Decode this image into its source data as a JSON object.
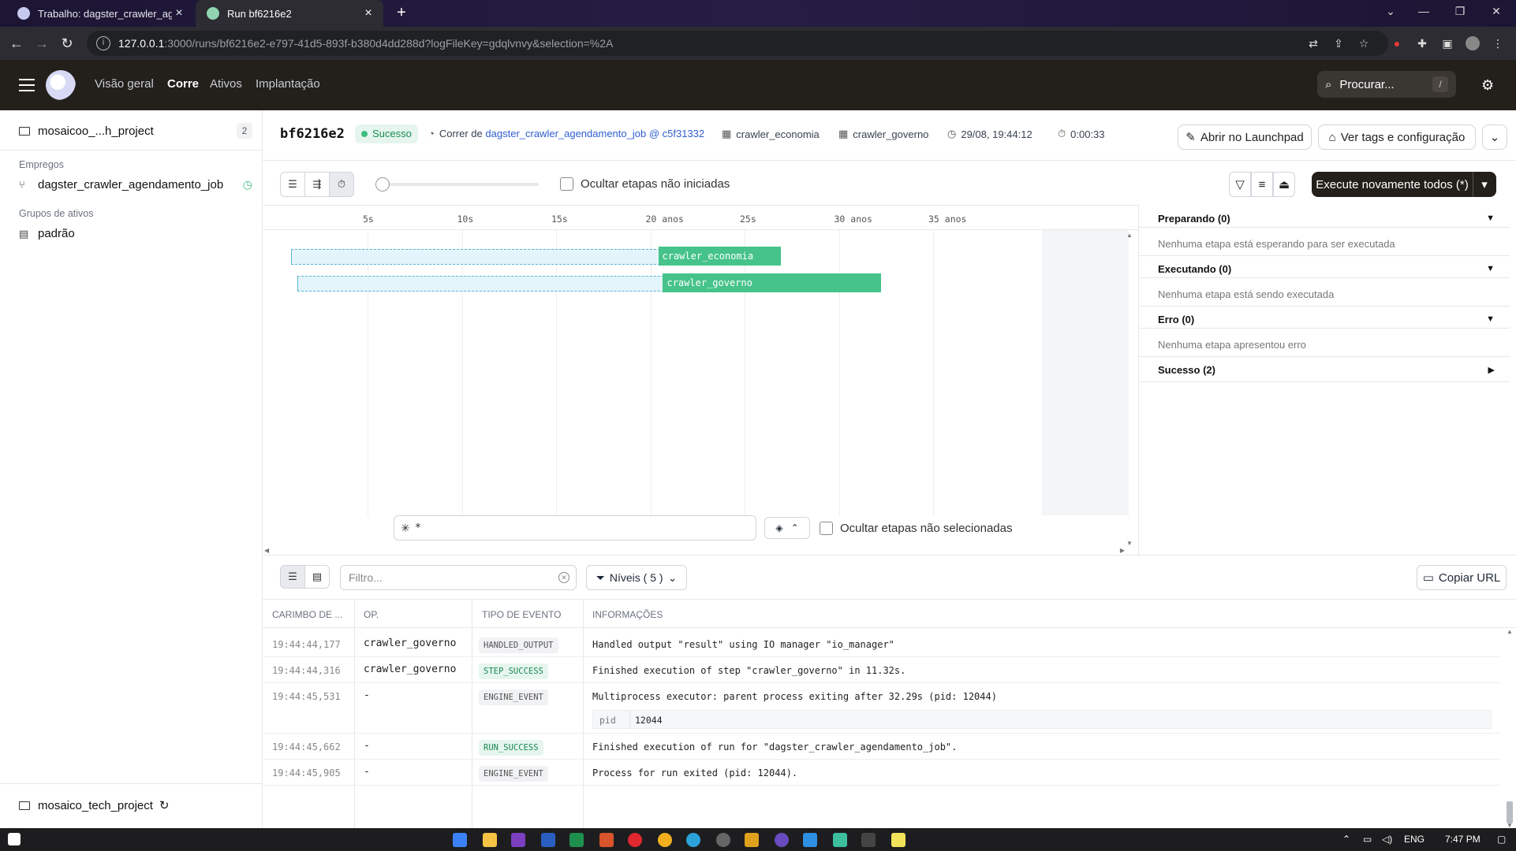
{
  "browser": {
    "tabs": [
      {
        "title": "Trabalho: dagster_crawler_agend",
        "active": false
      },
      {
        "title": "Run bf6216e2",
        "active": true
      }
    ],
    "url_host": "127.0.0.1",
    "url_rest": ":3000/runs/bf6216e2-e797-41d5-893f-b380d4dd288d?logFileKey=gdqlvnvy&selection=%2A"
  },
  "app_nav": {
    "items": [
      "Visão geral",
      "Corre",
      "Ativos",
      "Implantação"
    ],
    "current": "Corre",
    "search_placeholder": "Procurar...",
    "search_shortcut": "/"
  },
  "sidebar": {
    "project_name": "mosaicoo_...h_project",
    "project_count": "2",
    "jobs_section": "Empregos",
    "job_name": "dagster_crawler_agendamento_job",
    "asset_groups_section": "Grupos de ativos",
    "asset_group": "padrão",
    "bottom_project": "mosaico_tech_project"
  },
  "run": {
    "id": "bf6216e2",
    "status": "Sucesso",
    "run_of_label": "Correr de",
    "job_link": "dagster_crawler_agendamento_job",
    "snapshot": "@ c5f31332",
    "asset1": "crawler_economia",
    "asset2": "crawler_governo",
    "started": "29/08, 19:44:12",
    "duration": "0:00:33",
    "launchpad_button": "Abrir no Launchpad",
    "tags_button": "Ver tags e configuração",
    "reexecute_button": "Execute novamente todos (*)"
  },
  "gantt": {
    "hide_unstarted_label": "Ocultar etapas não iniciadas",
    "hide_unselected_label": "Ocultar etapas não selecionadas",
    "selector_query": "*",
    "ticks": [
      {
        "label": "5s",
        "t": 5
      },
      {
        "label": "10s",
        "t": 10
      },
      {
        "label": "15s",
        "t": 15
      },
      {
        "label": "20 anos",
        "t": 20
      },
      {
        "label": "25s",
        "t": 25
      },
      {
        "label": "30 anos",
        "t": 30
      },
      {
        "label": "35 anos",
        "t": 35
      }
    ],
    "steps": [
      {
        "name": "crawler_economia",
        "start": 20.0,
        "end": 26.5
      },
      {
        "name": "crawler_governo",
        "start": 20.25,
        "end": 31.8
      }
    ]
  },
  "status_panel": {
    "groups": [
      {
        "title": "Preparando (0)",
        "empty": "Nenhuma etapa está esperando para ser executada",
        "expanded": true
      },
      {
        "title": "Executando (0)",
        "empty": "Nenhuma etapa está sendo executada",
        "expanded": true
      },
      {
        "title": "Erro (0)",
        "empty": "Nenhuma etapa apresentou erro",
        "expanded": true
      },
      {
        "title": "Sucesso (2)",
        "empty": "",
        "expanded": false
      }
    ]
  },
  "logs": {
    "filter_placeholder": "Filtro...",
    "levels_label": "Níveis ( 5 )",
    "copy_url": "Copiar URL",
    "columns": [
      "CARIMBO DE ...",
      "OP.",
      "TIPO DE EVENTO",
      "INFORMAÇÕES"
    ],
    "rows": [
      {
        "ts": "19:44:44,177",
        "op": "crawler_governo",
        "event": "HANDLED_OUTPUT",
        "info": "Handled output \"result\" using IO manager \"io_manager\"",
        "ok": false
      },
      {
        "ts": "19:44:44,316",
        "op": "crawler_governo",
        "event": "STEP_SUCCESS",
        "info": "Finished execution of step \"crawler_governo\" in 11.32s.",
        "ok": true
      },
      {
        "ts": "19:44:45,531",
        "op": "-",
        "event": "ENGINE_EVENT",
        "info": "Multiprocess executor: parent process exiting after 32.29s (pid: 12044)",
        "ok": false,
        "kv_key": "pid",
        "kv_value": "12044"
      },
      {
        "ts": "19:44:45,662",
        "op": "-",
        "event": "RUN_SUCCESS",
        "info": "Finished execution of run for \"dagster_crawler_agendamento_job\".",
        "ok": true
      },
      {
        "ts": "19:44:45,905",
        "op": "-",
        "event": "ENGINE_EVENT",
        "info": "Process for run exited (pid: 12044).",
        "ok": false
      }
    ]
  },
  "taskbar": {
    "lang": "ENG",
    "time": "7:47 PM"
  },
  "colors": {
    "header_bg": "#231f1b",
    "success_green": "#45c38a",
    "link_blue": "#2f5fd0",
    "primary_button": "#231f1b"
  }
}
